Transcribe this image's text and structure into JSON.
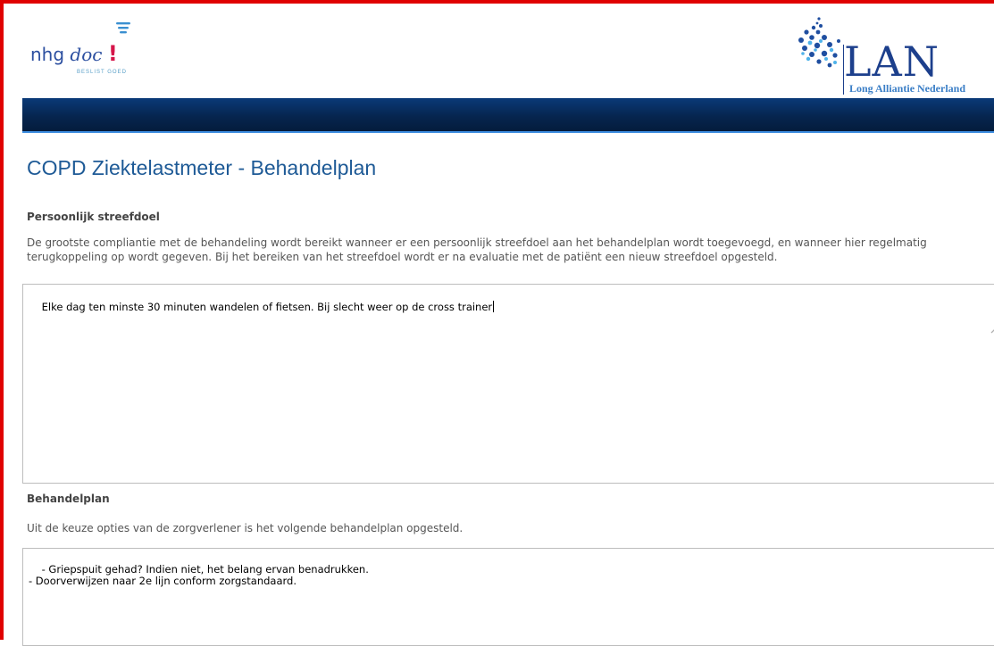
{
  "header": {
    "nhg_logo": {
      "brand_prefix": "nhg",
      "brand_suffix": "doc",
      "brand_mark": "!",
      "slogan": "BESLIST GOED"
    },
    "lan_logo": {
      "abbrev": "LAN",
      "full_name": "Long Alliantie Nederland"
    }
  },
  "colors": {
    "frame_border": "#e00000",
    "navbar": "#06254f",
    "navbar_accent": "#3d8de0",
    "title": "#1e5a96",
    "nhg_blue": "#2c4fa0",
    "nhg_red": "#d6164a"
  },
  "page": {
    "title": "COPD Ziektelastmeter - Behandelplan"
  },
  "goal_section": {
    "heading": "Persoonlijk streefdoel",
    "description": "De grootste compliantie met de behandeling wordt bereikt wanneer er een persoonlijk streefdoel aan het behandelplan wordt toegevoegd, en wanneer hier regelmatig terugkoppeling op wordt gegeven. Bij het bereiken van het streefdoel wordt er na evaluatie met de patiënt een nieuw streefdoel opgesteld.",
    "textarea_value": "Elke dag ten minste 30 minuten wandelen of fietsen. Bij slecht weer op de cross trainer"
  },
  "plan_section": {
    "heading": "Behandelplan",
    "description": "Uit de keuze opties van de zorgverlener is het volgende behandelplan opgesteld.",
    "textarea_value": "- Griepspuit gehad? Indien niet, het belang ervan benadrukken.\n- Doorverwijzen naar 2e lijn conform zorgstandaard."
  },
  "icons": [
    "wifi-signal-icon",
    "lan-dots-icon",
    "chevron-up-icon",
    "chevron-down-icon"
  ]
}
